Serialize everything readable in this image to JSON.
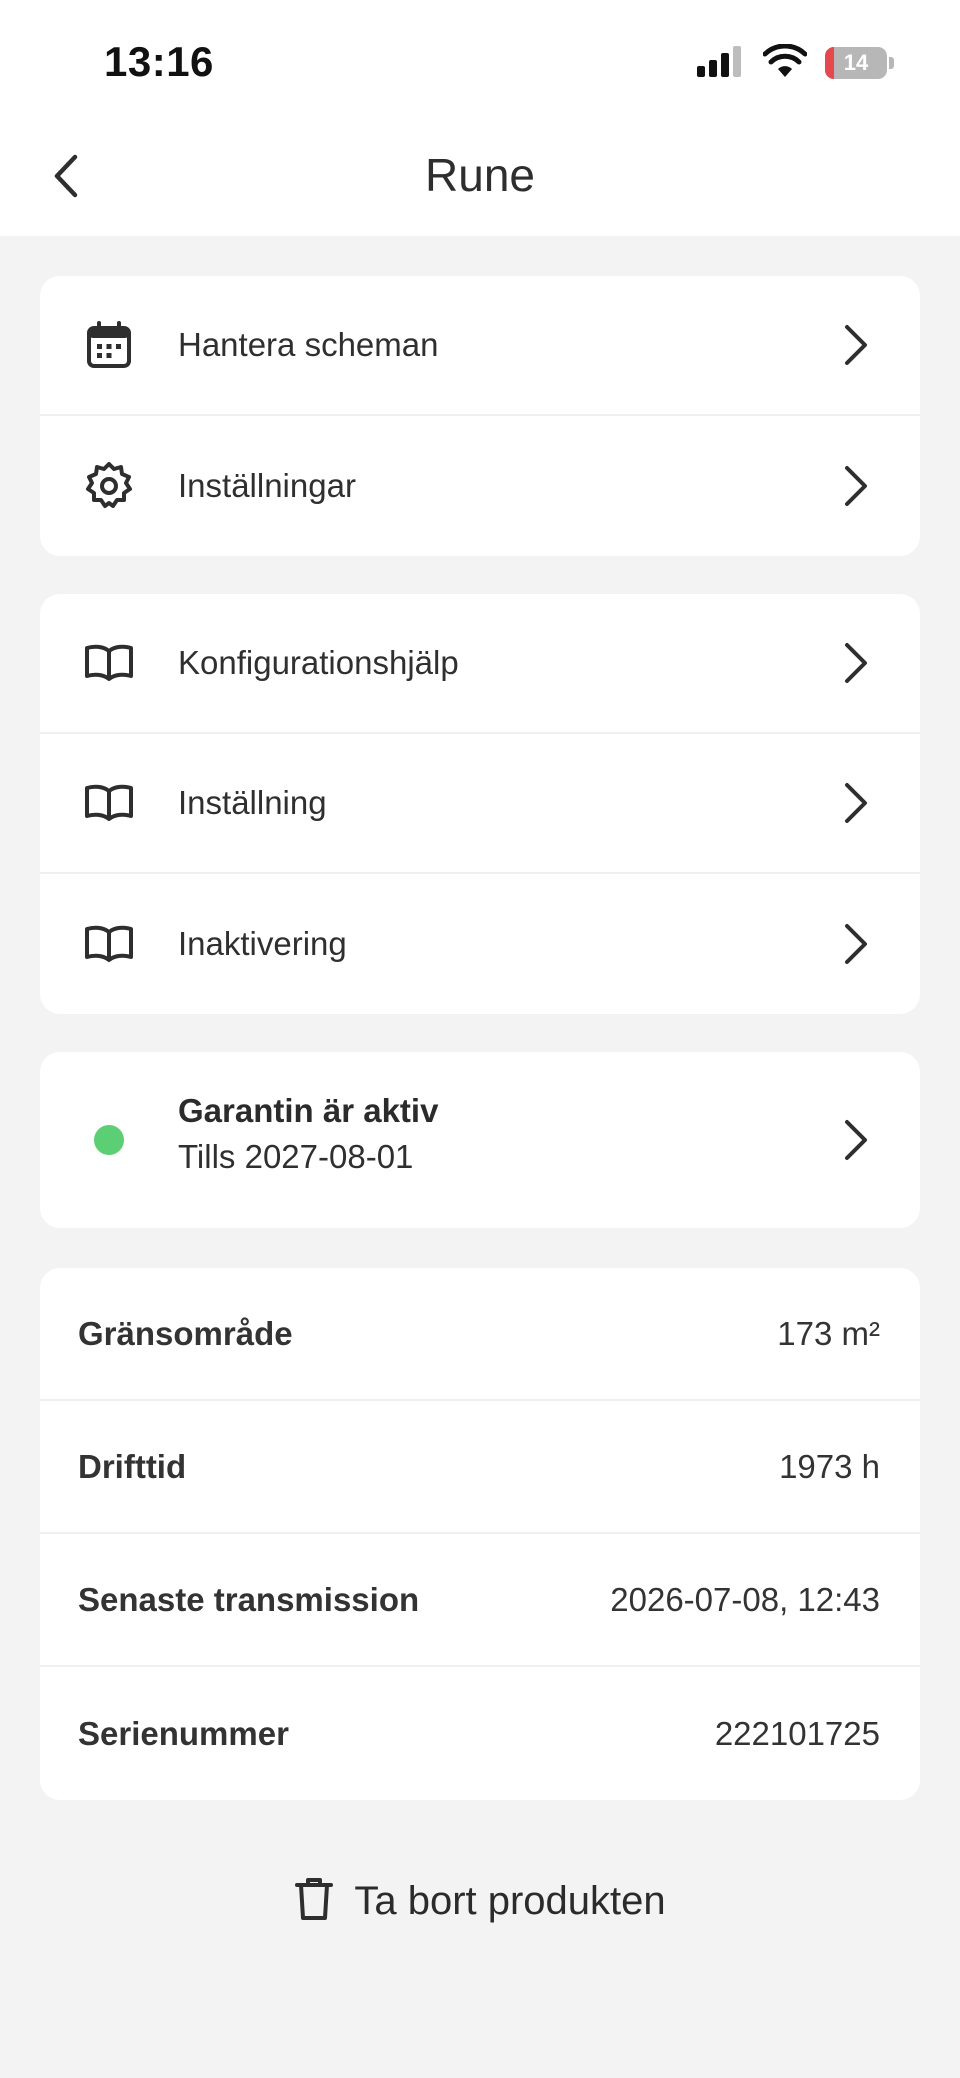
{
  "status_bar": {
    "time": "13:16",
    "battery": "14",
    "battery_level": 0.14
  },
  "header": {
    "title": "Rune"
  },
  "menu_groups": [
    {
      "items": [
        {
          "label": "Hantera scheman",
          "icon": "calendar-icon"
        },
        {
          "label": "Inställningar",
          "icon": "gear-icon"
        }
      ]
    },
    {
      "items": [
        {
          "label": "Konfigurationshjälp",
          "icon": "book-icon"
        },
        {
          "label": "Inställning",
          "icon": "book-icon"
        },
        {
          "label": "Inaktivering",
          "icon": "book-icon"
        }
      ]
    }
  ],
  "warranty": {
    "title": "Garantin är aktiv",
    "subtitle": "Tills 2027-08-01",
    "status_color": "#5ccf75"
  },
  "info": [
    {
      "key": "Gränsområde",
      "value": "173 m²"
    },
    {
      "key": "Drifttid",
      "value": "1973 h"
    },
    {
      "key": "Senaste transmission",
      "value": "2026-07-08, 12:43"
    },
    {
      "key": "Serienummer",
      "value": "222101725"
    }
  ],
  "delete_action": {
    "label": "Ta bort produkten",
    "icon": "trash-icon"
  }
}
